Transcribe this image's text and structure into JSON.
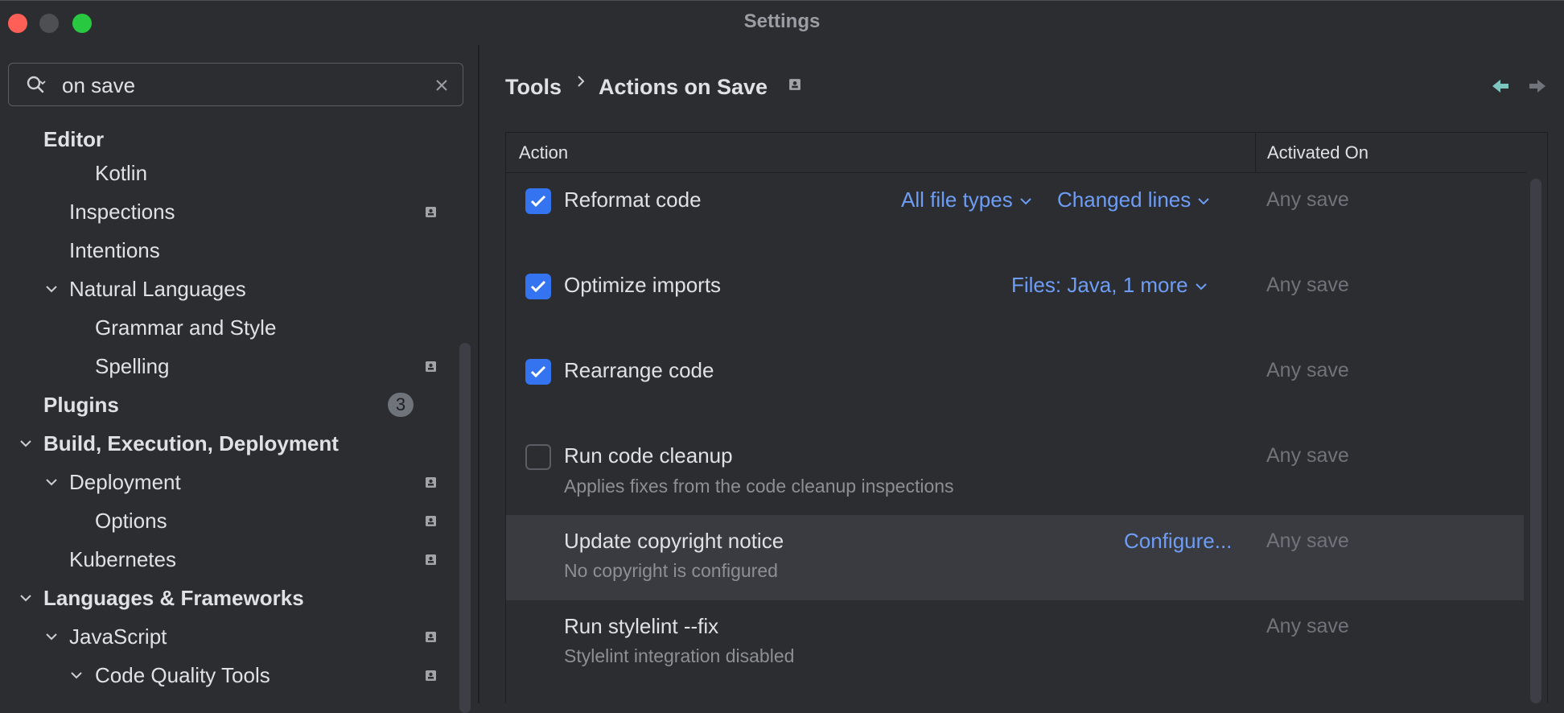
{
  "window": {
    "title": "Settings"
  },
  "search": {
    "value": "on save"
  },
  "sidebar": {
    "items": [
      {
        "label": "Editor"
      },
      {
        "label": "Kotlin"
      },
      {
        "label": "Inspections"
      },
      {
        "label": "Intentions"
      },
      {
        "label": "Natural Languages"
      },
      {
        "label": "Grammar and Style"
      },
      {
        "label": "Spelling"
      },
      {
        "label": "Plugins",
        "badge": "3"
      },
      {
        "label": "Build, Execution, Deployment"
      },
      {
        "label": "Deployment"
      },
      {
        "label": "Options"
      },
      {
        "label": "Kubernetes"
      },
      {
        "label": "Languages & Frameworks"
      },
      {
        "label": "JavaScript"
      },
      {
        "label": "Code Quality Tools"
      }
    ]
  },
  "breadcrumb": {
    "parent": "Tools",
    "current": "Actions on Save"
  },
  "table": {
    "headers": {
      "action": "Action",
      "activated": "Activated On"
    },
    "rows": [
      {
        "title": "Reformat code",
        "checked": true,
        "links": [
          "All file types",
          "Changed lines"
        ],
        "activated": "Any save"
      },
      {
        "title": "Optimize imports",
        "checked": true,
        "links": [
          "Files: Java, 1 more"
        ],
        "activated": "Any save"
      },
      {
        "title": "Rearrange code",
        "checked": true,
        "activated": "Any save"
      },
      {
        "title": "Run code cleanup",
        "checked": false,
        "description": "Applies fixes from the code cleanup inspections",
        "activated": "Any save"
      },
      {
        "title": "Update copyright notice",
        "description": "No copyright is configured",
        "link": "Configure...",
        "activated": "Any save"
      },
      {
        "title": "Run stylelint --fix",
        "description": "Stylelint integration disabled",
        "activated": "Any save"
      }
    ]
  },
  "colors": {
    "accent": "#3574f0",
    "link": "#6e9df6",
    "background": "#2b2d30"
  }
}
